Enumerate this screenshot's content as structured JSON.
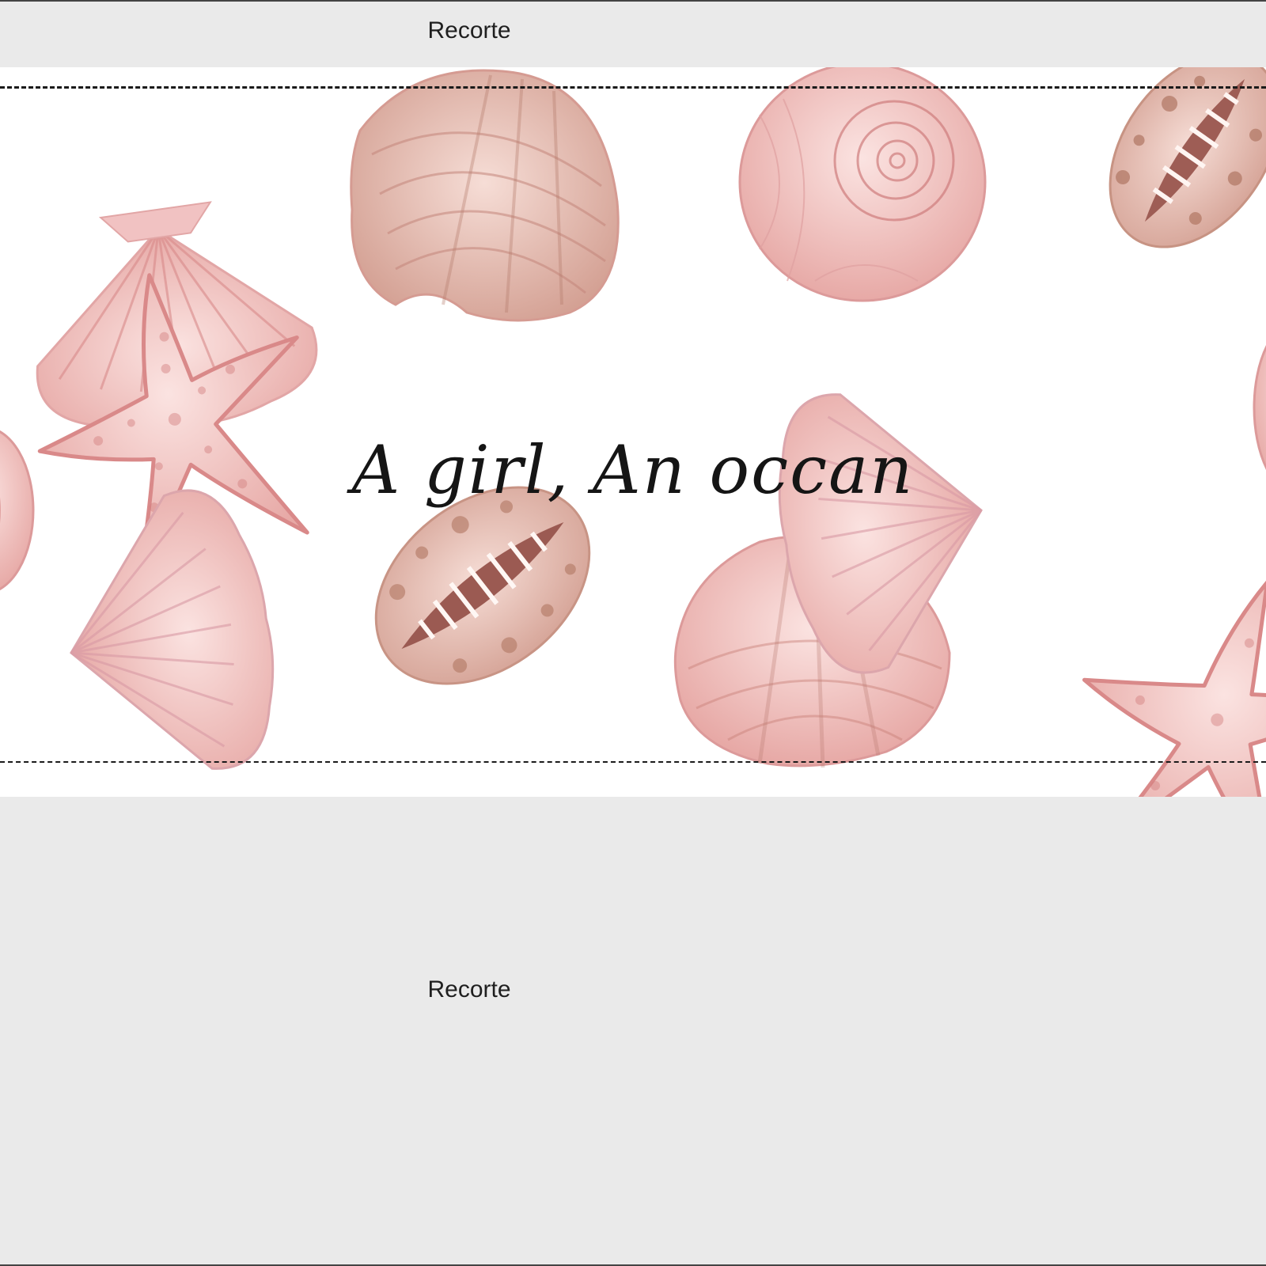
{
  "crop_label_top": "Recorte",
  "crop_label_bottom": "Recorte",
  "design": {
    "title": "A girl, An occan",
    "colors": {
      "shell_pink": "#f2c3c3",
      "shell_deep": "#d98a8a",
      "shell_brown": "#b47a6a",
      "cut_line": "#1a1a1a",
      "workspace": "#eaeaea"
    },
    "decorations": [
      "scallop-shell-icon",
      "clam-shell-icon",
      "spiral-shell-icon",
      "cowrie-shell-icon",
      "starfish-icon",
      "scallop-shell-icon",
      "cowrie-shell-icon",
      "clam-shell-icon",
      "scallop-shell-icon",
      "starfish-icon"
    ]
  }
}
